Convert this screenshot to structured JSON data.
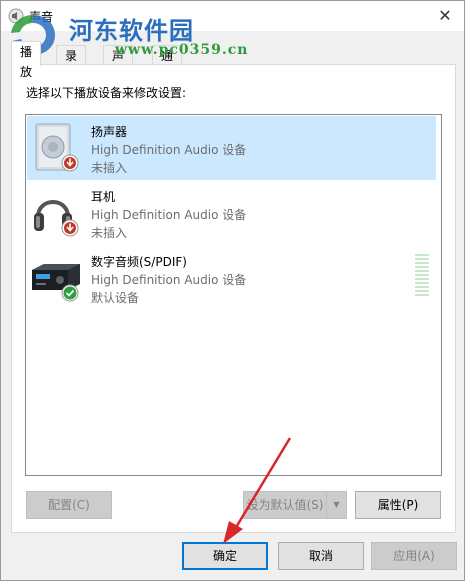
{
  "window": {
    "title": "声音"
  },
  "watermark": {
    "site_name": "河东软件园",
    "url": "www.pc0359.cn"
  },
  "tabs": [
    {
      "label": "播放",
      "active": true
    },
    {
      "label": "录制",
      "active": false
    },
    {
      "label": "声音",
      "active": false
    },
    {
      "label": "通信",
      "active": false
    }
  ],
  "instruction": "选择以下播放设备来修改设置:",
  "devices": [
    {
      "name": "扬声器",
      "driver": "High Definition Audio 设备",
      "status": "未插入",
      "icon": "speaker-icon",
      "badge": "unplugged-down-arrow-badge",
      "selected": true
    },
    {
      "name": "耳机",
      "driver": "High Definition Audio 设备",
      "status": "未插入",
      "icon": "headphones-icon",
      "badge": "unplugged-down-arrow-badge",
      "selected": false
    },
    {
      "name": "数字音频(S/PDIF)",
      "driver": "High Definition Audio 设备",
      "status": "默认设备",
      "icon": "digital-audio-receiver-icon",
      "badge": "default-check-badge",
      "selected": false
    }
  ],
  "buttons": {
    "configure": "配置(C)",
    "set_default": "设为默认值(S)",
    "properties": "属性(P)",
    "ok": "确定",
    "cancel": "取消",
    "apply": "应用(A)"
  },
  "colors": {
    "selection": "#cce8ff",
    "accent": "#0078d7",
    "annotation_arrow": "#d9262b"
  }
}
